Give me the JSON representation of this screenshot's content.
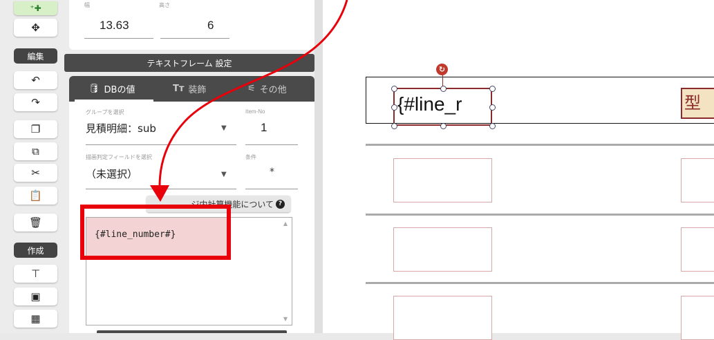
{
  "toolbar": {
    "edit_header": "編集",
    "create_header": "作成",
    "icons": [
      "plus-move-icon",
      "move-icon",
      "undo-icon",
      "redo-icon",
      "copy-icon",
      "duplicate-icon",
      "cut-icon",
      "paste-icon",
      "trash-icon",
      "text-frame-icon",
      "image-icon",
      "qrcode-icon"
    ]
  },
  "size": {
    "width_label": "幅",
    "height_label": "高さ",
    "width_value": "13.63",
    "height_value": "6"
  },
  "text_frame_settings": "テキストフレーム 設定",
  "tabs": [
    {
      "label": "DBの値"
    },
    {
      "label": "装飾"
    },
    {
      "label": "その他"
    }
  ],
  "group": {
    "label": "グループを選択",
    "value": "見積明細：sub"
  },
  "item_no": {
    "label": "Item-No",
    "value": "1"
  },
  "draw_field": {
    "label": "描画判定フィールドを選択",
    "value": "（未選択）"
  },
  "condition": {
    "label": "条件",
    "value": "*"
  },
  "calc_help_button": "ジ内計算機能について",
  "textarea_value": "{#line_number#}",
  "canvas": {
    "selected_text": "{#line_r",
    "type_field_text": "型"
  }
}
